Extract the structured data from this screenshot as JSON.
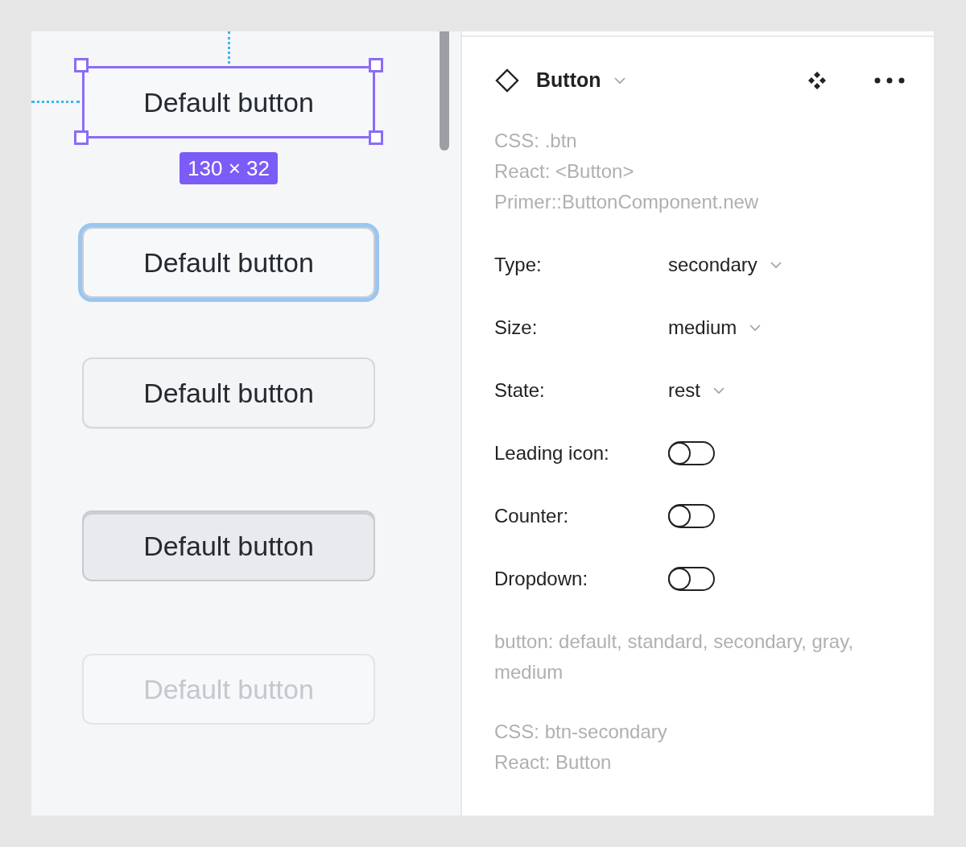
{
  "canvas": {
    "size_badge": "130 × 32",
    "buttons": [
      {
        "label": "Default button",
        "kind": "selected"
      },
      {
        "label": "Default button",
        "kind": "focus"
      },
      {
        "label": "Default button",
        "kind": "rest"
      },
      {
        "label": "Default button",
        "kind": "pressed"
      },
      {
        "label": "Default button",
        "kind": "disabled"
      }
    ]
  },
  "panel": {
    "title": "Button",
    "code_lines": [
      "CSS: .btn",
      "React: <Button>",
      "Primer::ButtonComponent.new"
    ],
    "properties": [
      {
        "label": "Type:",
        "kind": "select",
        "value": "secondary"
      },
      {
        "label": "Size:",
        "kind": "select",
        "value": "medium"
      },
      {
        "label": "State:",
        "kind": "select",
        "value": "rest"
      },
      {
        "label": "Leading icon:",
        "kind": "toggle",
        "on": false
      },
      {
        "label": "Counter:",
        "kind": "toggle",
        "on": false
      },
      {
        "label": "Dropdown:",
        "kind": "toggle",
        "on": false
      }
    ],
    "description": "button: default, standard, secondary, gray, medium",
    "footer_lines": [
      "CSS: btn-secondary",
      "React: Button"
    ]
  }
}
